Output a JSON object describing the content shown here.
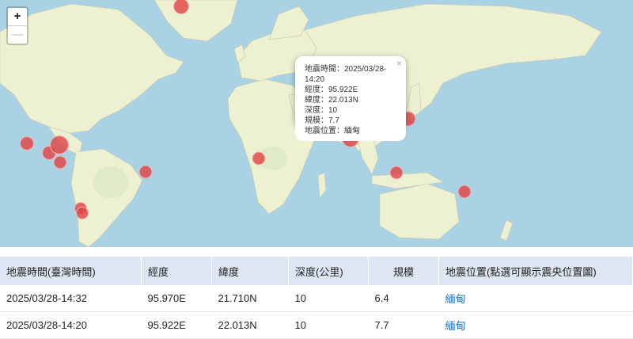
{
  "map": {
    "zoom_in_label": "+",
    "zoom_out_label": "—",
    "marker_color": "#e14646"
  },
  "popup": {
    "close_label": "×",
    "lines": [
      "地震時間：2025/03/28-14:20",
      "經度：95.922E",
      "緯度：22.013N",
      "深度：10",
      "規模：7.7",
      "地震位置：緬甸"
    ]
  },
  "table": {
    "headers": [
      "地震時間(臺灣時間)",
      "經度",
      "緯度",
      "深度(公里)",
      "規模",
      "地震位置(點選可顯示震央位置圖)"
    ],
    "rows": [
      {
        "time": "2025/03/28-14:32",
        "lon": "95.970E",
        "lat": "21.710N",
        "depth": "10",
        "mag": "6.4",
        "location": "緬甸"
      },
      {
        "time": "2025/03/28-14:20",
        "lon": "95.922E",
        "lat": "22.013N",
        "depth": "10",
        "mag": "7.7",
        "location": "緬甸"
      }
    ]
  }
}
